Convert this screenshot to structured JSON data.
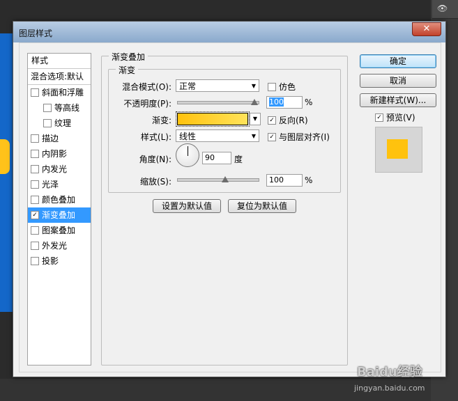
{
  "dialog": {
    "title": "图层样式",
    "close_glyph": "✕"
  },
  "sidebar": {
    "header": "样式",
    "blend_options": "混合选项:默认",
    "items": [
      {
        "label": "斜面和浮雕",
        "checked": false
      },
      {
        "label": "等高线",
        "checked": false,
        "sub": true
      },
      {
        "label": "纹理",
        "checked": false,
        "sub": true
      },
      {
        "label": "描边",
        "checked": false
      },
      {
        "label": "内阴影",
        "checked": false
      },
      {
        "label": "内发光",
        "checked": false
      },
      {
        "label": "光泽",
        "checked": false
      },
      {
        "label": "颜色叠加",
        "checked": false
      },
      {
        "label": "渐变叠加",
        "checked": true,
        "selected": true
      },
      {
        "label": "图案叠加",
        "checked": false
      },
      {
        "label": "外发光",
        "checked": false
      },
      {
        "label": "投影",
        "checked": false
      }
    ]
  },
  "gradient_overlay": {
    "section_title": "渐变叠加",
    "group_title": "渐变",
    "blend_mode_label": "混合模式(O):",
    "blend_mode_value": "正常",
    "dither_label": "仿色",
    "opacity_label": "不透明度(P):",
    "opacity_value": "100",
    "opacity_unit": "%",
    "gradient_label": "渐变:",
    "reverse_label": "反向(R)",
    "style_label": "样式(L):",
    "style_value": "线性",
    "align_label": "与图层对齐(I)",
    "angle_label": "角度(N):",
    "angle_value": "90",
    "angle_unit": "度",
    "scale_label": "缩放(S):",
    "scale_value": "100",
    "scale_unit": "%",
    "make_default": "设置为默认值",
    "reset_default": "复位为默认值",
    "colors": {
      "gradient_start": "#ffc20e",
      "gradient_end": "#ffe35a"
    }
  },
  "buttons": {
    "ok": "确定",
    "cancel": "取消",
    "new_style": "新建样式(W)...",
    "preview_label": "预览(V)"
  },
  "watermark": {
    "brand": "Baidu经验",
    "url": "jingyan.baidu.com"
  }
}
